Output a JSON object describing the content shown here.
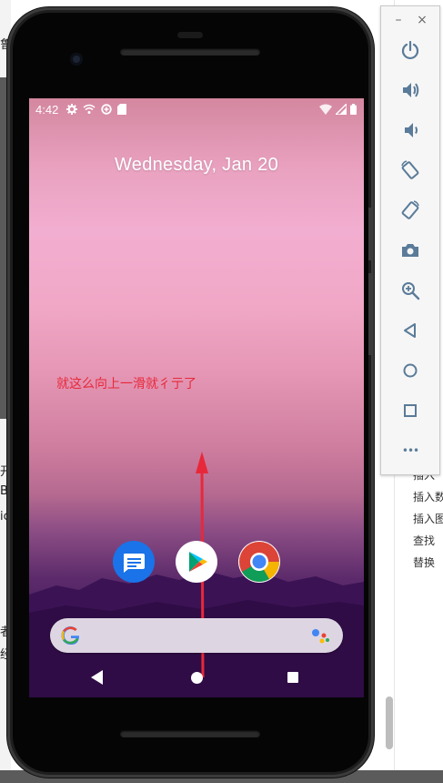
{
  "background": {
    "left_fragments": [
      "鲁",
      "开",
      "B",
      "ic",
      "者",
      "经"
    ],
    "right_items": [
      "插入",
      "插入数",
      "插入图",
      "查找",
      "替换"
    ]
  },
  "status_bar": {
    "time": "4:42",
    "left_icons": [
      "settings-icon",
      "wifi-calling-icon",
      "data-saver-icon",
      "sd-card-icon"
    ],
    "right_icons": [
      "wifi-icon",
      "signal-icon",
      "battery-icon"
    ]
  },
  "home": {
    "date": "Wednesday, Jan 20",
    "annotation": "就这么向上一滑就彳亍了",
    "dock_apps": [
      "messages-app-icon",
      "play-store-app-icon",
      "chrome-app-icon"
    ]
  },
  "search_bar": {
    "left_icon": "google-g-icon",
    "right_icon": "google-assistant-icon"
  },
  "navbar": {
    "buttons": [
      "back",
      "home",
      "recents"
    ]
  },
  "emulator_toolbar": {
    "minimize_label": "–",
    "close_label": "×",
    "more_label": "•••",
    "buttons": [
      "power",
      "volume-up",
      "volume-down",
      "rotate-left",
      "rotate-right",
      "screenshot",
      "zoom",
      "back",
      "home",
      "overview",
      "more"
    ]
  },
  "colors": {
    "annotation": "#e8283a",
    "arrow": "#e8283a",
    "toolbar_icon": "#5a7b99"
  }
}
